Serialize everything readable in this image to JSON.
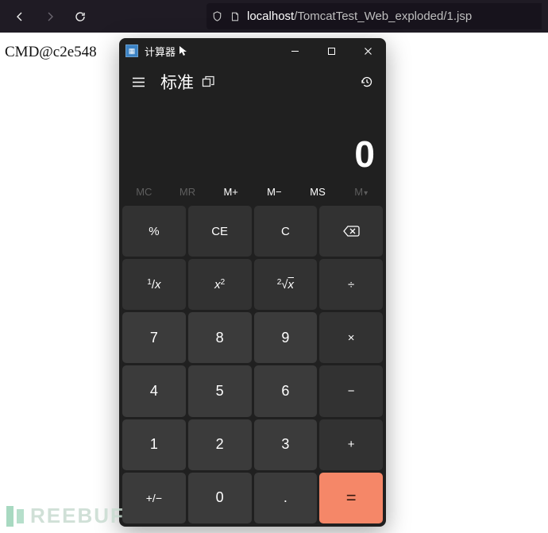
{
  "browser": {
    "host": "localhost",
    "path": "/TomcatTest_Web_exploded/1.jsp"
  },
  "page_text": "CMD@c2e548",
  "calc": {
    "title": "计算器",
    "mode": "标准",
    "display": "0",
    "memory": [
      "MC",
      "MR",
      "M+",
      "M−",
      "MS",
      "M"
    ],
    "keys": [
      [
        "%",
        "CE",
        "C",
        "⌫"
      ],
      [
        "¹⁄ₓ",
        "x²",
        "²√x",
        "÷"
      ],
      [
        "7",
        "8",
        "9",
        "×"
      ],
      [
        "4",
        "5",
        "6",
        "−"
      ],
      [
        "1",
        "2",
        "3",
        "+"
      ],
      [
        "+/−",
        "0",
        ".",
        "="
      ]
    ]
  },
  "watermark": "REEBUF"
}
